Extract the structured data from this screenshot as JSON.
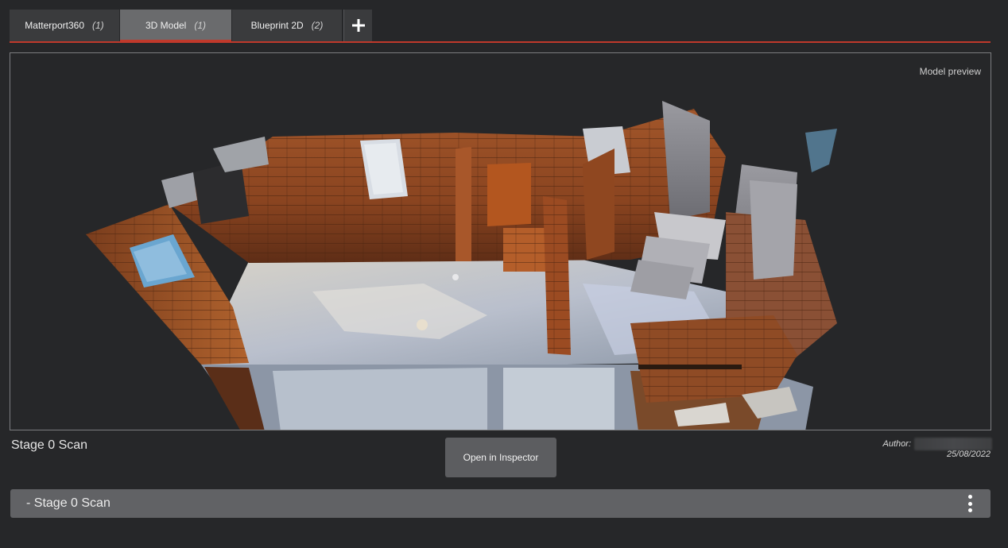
{
  "tabs": [
    {
      "label": "Matterport360",
      "count": "(1)"
    },
    {
      "label": "3D Model",
      "count": "(1)"
    },
    {
      "label": "Blueprint 2D",
      "count": "(2)"
    }
  ],
  "preview": {
    "label": "Model preview"
  },
  "model": {
    "title": "Stage 0 Scan",
    "author_label": "Author:",
    "date": "25/08/2022"
  },
  "actions": {
    "open_inspector": "Open in Inspector"
  },
  "scan_list": {
    "item_label": "- Stage 0 Scan"
  },
  "colors": {
    "accent": "#c0392b",
    "background": "#262729",
    "tab_active": "#6a6b6d",
    "tab": "#3a3b3d"
  }
}
